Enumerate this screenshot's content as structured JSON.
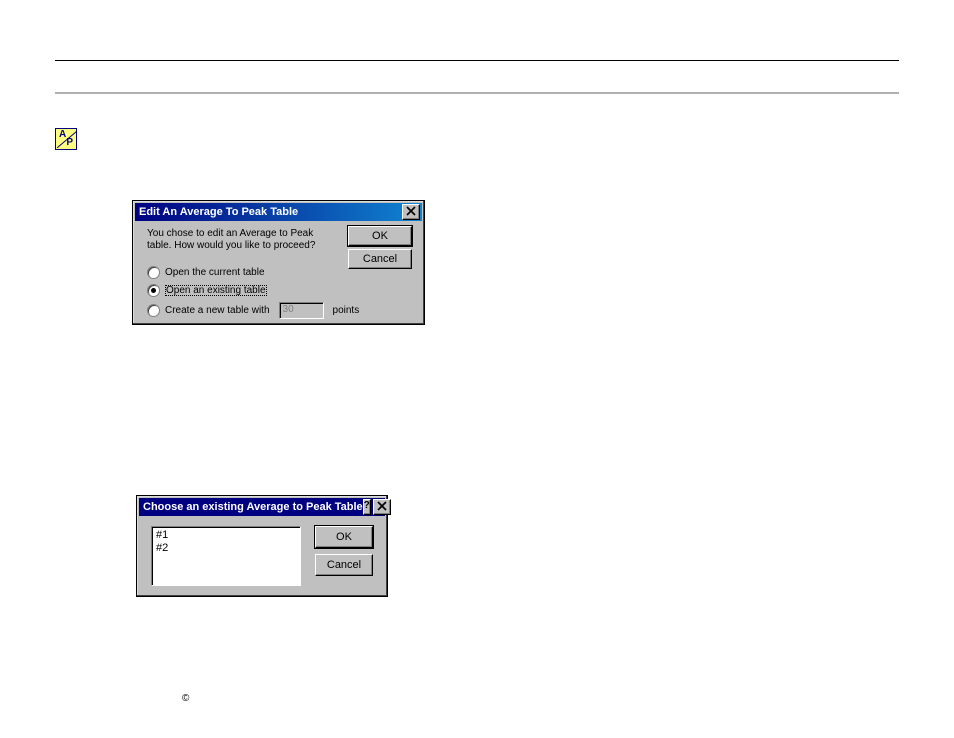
{
  "icon": {
    "tooltip": "A/P"
  },
  "dialog1": {
    "title": "Edit An Average To Peak Table",
    "message": "You chose to edit an Average to Peak table.  How would you like to proceed?",
    "buttons": {
      "ok": "OK",
      "cancel": "Cancel"
    },
    "options": {
      "open_current": "Open the current table",
      "open_existing": "Open an existing table",
      "create_new_prefix": "Create a new table with",
      "create_new_points_value": "30",
      "create_new_suffix": "points"
    },
    "selected": "open_existing"
  },
  "dialog2": {
    "title": "Choose an existing Average to Peak Table",
    "buttons": {
      "ok": "OK",
      "cancel": "Cancel"
    },
    "items": [
      "#1",
      "#2"
    ]
  },
  "footer": "©"
}
